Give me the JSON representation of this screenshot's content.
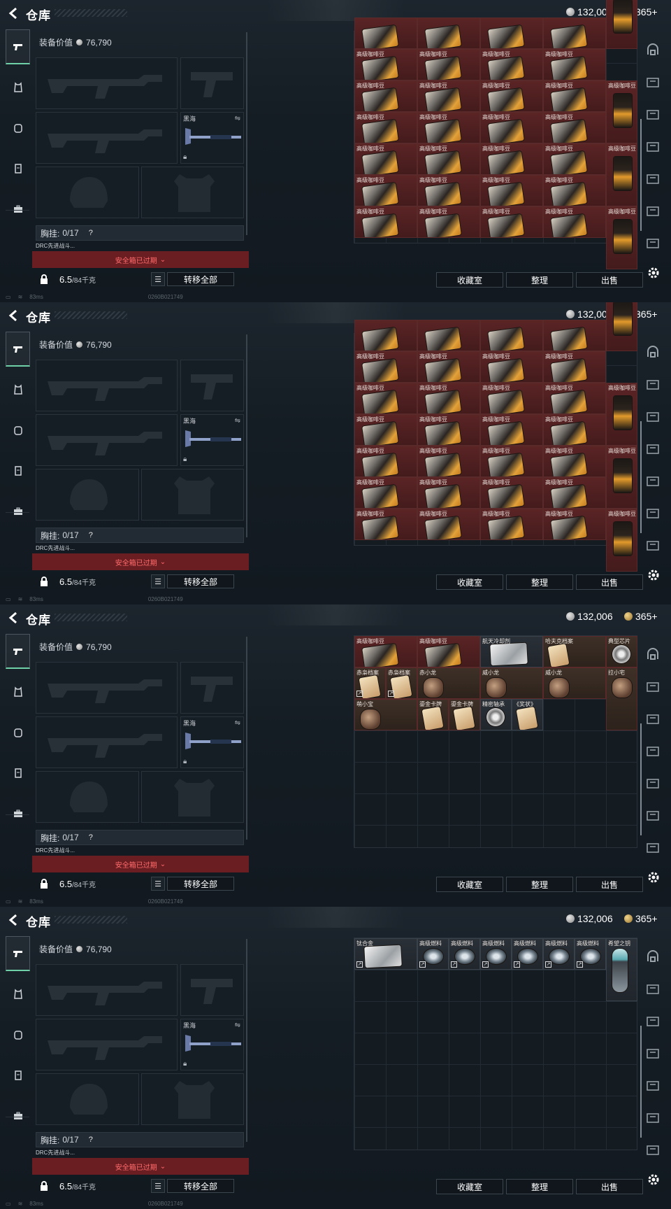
{
  "header": {
    "title": "仓库",
    "silver": "132,006",
    "gold": "365+"
  },
  "leftnav": {
    "items": [
      "weapon-icon",
      "armor-icon",
      "vest-icon",
      "backpack-icon",
      "case-icon"
    ]
  },
  "loadout": {
    "value_label": "装备价值",
    "value": "76,790",
    "secondary_slot_name": "黑海",
    "chest_label": "胸挂:",
    "chest_count": "0/17",
    "chest_help": "?",
    "drc_label": "DRC先进战斗...",
    "expired_text": "安全箱已过期",
    "weight": "6.5",
    "weight_cap": "/84千克",
    "transfer_all": "转移全部"
  },
  "status": {
    "ping": "83ms",
    "id": "0260B021749"
  },
  "actions": {
    "collection": "收藏室",
    "organize": "整理",
    "sell": "出售"
  },
  "items": {
    "coffee": "高级咖啡豆",
    "aerospace_coolant": "航天冷却剂",
    "hafu_archive": "哈夫克档案",
    "cpu": "典型芯片",
    "red_archive": "赤枭档案",
    "chi_xiao_long": "赤小龙",
    "wei_xiao_long": "威小龙",
    "la_xiao_zai": "拉小宅",
    "meng_xiao_bao": "萌小宝",
    "gold_card": "鎏金卡牌",
    "gear_bearing": "精密轴承",
    "prize_ticket": "《奖状》",
    "titanium": "钛合金",
    "fuel": "高级燃料",
    "hope_key": "希望之钥"
  }
}
